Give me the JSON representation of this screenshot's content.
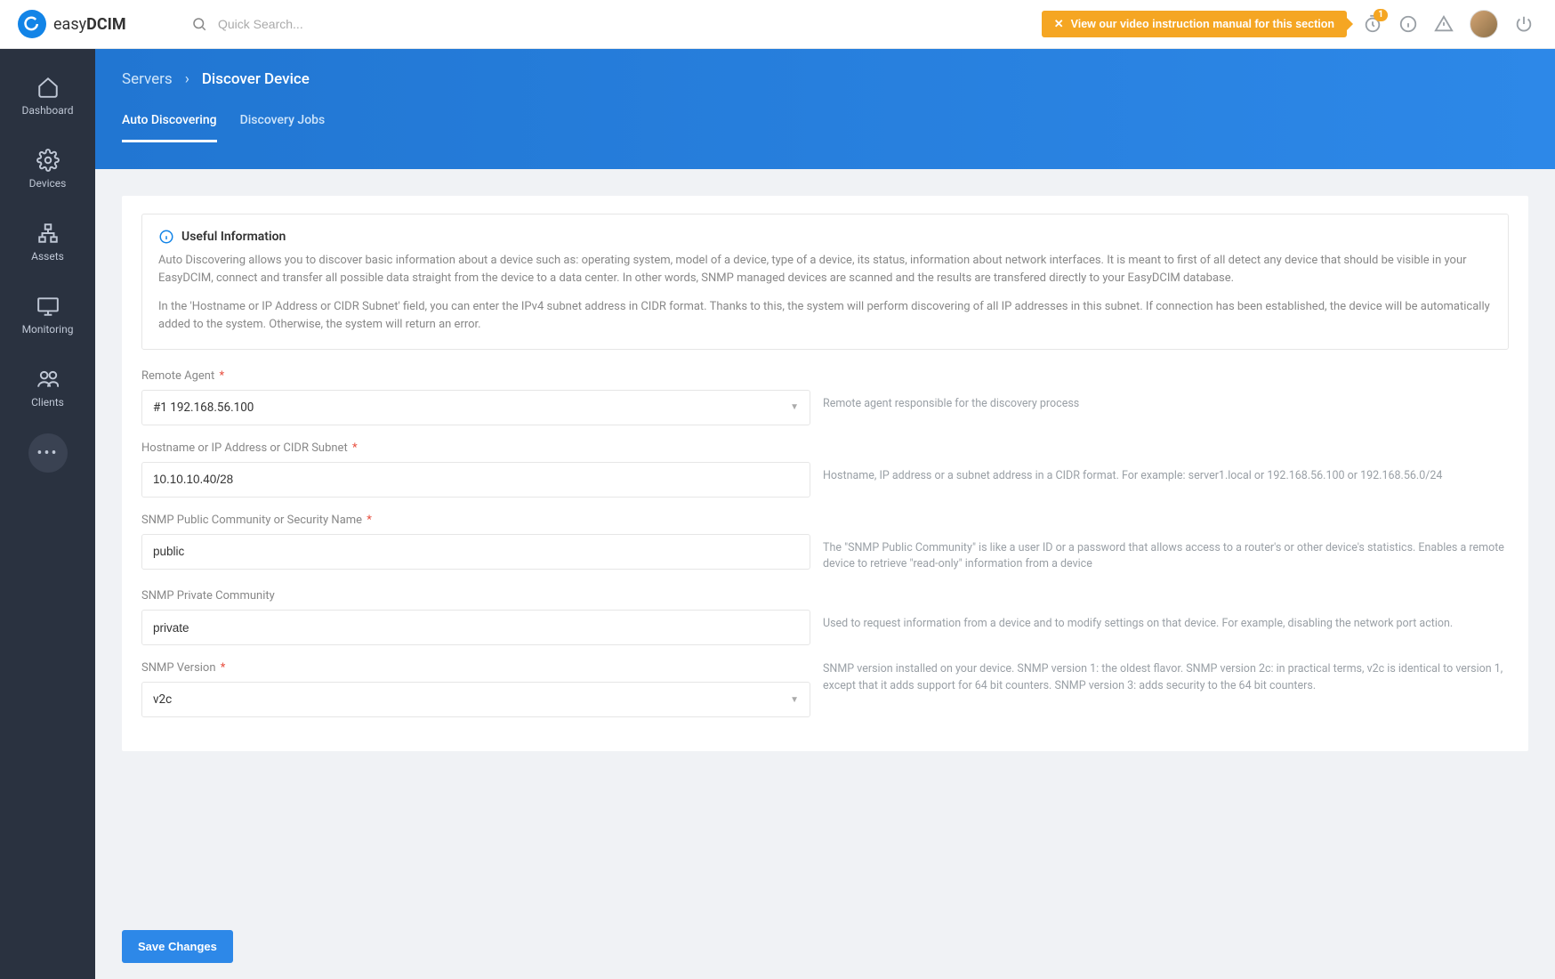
{
  "app": {
    "logo_prefix": "easy",
    "logo_suffix": "DCIM"
  },
  "search": {
    "placeholder": "Quick Search..."
  },
  "header": {
    "banner": "View our video instruction manual for this section",
    "badge_count": "1"
  },
  "sidebar": {
    "items": [
      {
        "label": "Dashboard"
      },
      {
        "label": "Devices"
      },
      {
        "label": "Assets"
      },
      {
        "label": "Monitoring"
      },
      {
        "label": "Clients"
      }
    ]
  },
  "breadcrumb": {
    "parent": "Servers",
    "current": "Discover Device"
  },
  "tabs": [
    {
      "label": "Auto Discovering",
      "active": true
    },
    {
      "label": "Discovery Jobs",
      "active": false
    }
  ],
  "info": {
    "title": "Useful Information",
    "p1": "Auto Discovering allows you to discover basic information about a device such as: operating system, model of a device, type of a device, its status, information about network interfaces. It is meant to first of all detect any device that should be visible in your EasyDCIM, connect and transfer all possible data straight from the device to a data center. In other words, SNMP managed devices are scanned and the results are transfered directly to your EasyDCIM database.",
    "p2": "In the 'Hostname or IP Address or CIDR Subnet' field, you can enter the IPv4 subnet address in CIDR format. Thanks to this, the system will perform discovering of all IP addresses in this subnet. If connection has been established, the device will be automatically added to the system. Otherwise, the system will return an error."
  },
  "form": {
    "remote_agent": {
      "label": "Remote Agent",
      "value": "#1 192.168.56.100",
      "help": "Remote agent responsible for the discovery process"
    },
    "hostname": {
      "label": "Hostname or IP Address or CIDR Subnet",
      "value": "10.10.10.40/28",
      "help": "Hostname, IP address or a subnet address in a CIDR format. For example: server1.local or 192.168.56.100 or 192.168.56.0/24"
    },
    "snmp_public": {
      "label": "SNMP Public Community or Security Name",
      "value": "public",
      "help": "The \"SNMP Public Community\" is like a user ID or a password that allows access to a router's or other device's statistics. Enables a remote device to retrieve \"read-only\" information from a device"
    },
    "snmp_private": {
      "label": "SNMP Private Community",
      "value": "private",
      "help": "Used to request information from a device and to modify settings on that device. For example, disabling the network port action."
    },
    "snmp_version": {
      "label": "SNMP Version",
      "value": "v2c",
      "help": "SNMP version installed on your device. SNMP version 1: the oldest flavor. SNMP version 2c: in practical terms, v2c is identical to version 1, except that it adds support for 64 bit counters. SNMP version 3: adds security to the 64 bit counters."
    }
  },
  "footer": {
    "save": "Save Changes"
  }
}
